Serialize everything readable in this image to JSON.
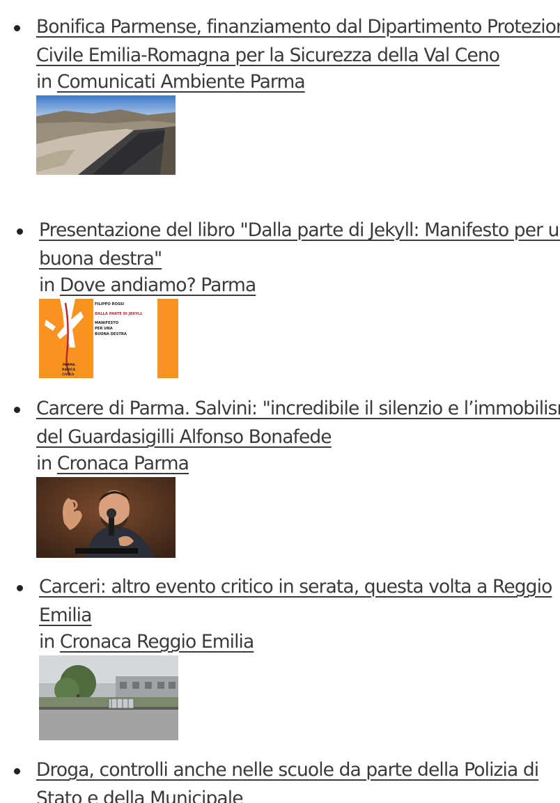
{
  "items": [
    {
      "title": "Bonifica Parmense, finanziamento dal Dipartimento Protezione Civile Emilia-Romagna per la Sicurezza della Val Ceno",
      "in_prefix": "in",
      "category": "Comunicati Ambiente Parma",
      "image": "riverbed-construction"
    },
    {
      "title": "Presentazione del libro \"Dalla parte di Jekyll: Manifesto per una buona destra\"",
      "in_prefix": "in",
      "category": "Dove andiamo? Parma",
      "image": "book-cover",
      "image_text": {
        "author": "FILIPPO ROSSI",
        "book_title": "DALLA PARTE DI JEKYLL",
        "subtitle_1": "MANIFESTO",
        "subtitle_2": "PER UNA",
        "subtitle_3": "BUONA DESTRA",
        "stamp_1": "PARMA",
        "stamp_2": "RADICA",
        "stamp_3": "CIVICO"
      }
    },
    {
      "title": "Carcere di Parma. Salvini: \"incredibile il silenzio e l’immobilismo del Guardasigilli Alfonso Bonafede",
      "in_prefix": "in",
      "category": "Cronaca Parma",
      "image": "speaker-photo"
    },
    {
      "title": "Carceri: altro evento critico in serata, questa volta a Reggio Emilia",
      "in_prefix": "in",
      "category": "Cronaca Reggio Emilia",
      "image": "prison-street"
    },
    {
      "title": "Droga, controlli anche nelle scuole da parte della Polizia di Stato e della Municipale",
      "in_prefix": "in",
      "category": "",
      "image": ""
    }
  ],
  "colors": {
    "text": "#3a3a3a",
    "bullet": "#222222",
    "background": "#ffffff",
    "book_orange": "#f7931e"
  }
}
